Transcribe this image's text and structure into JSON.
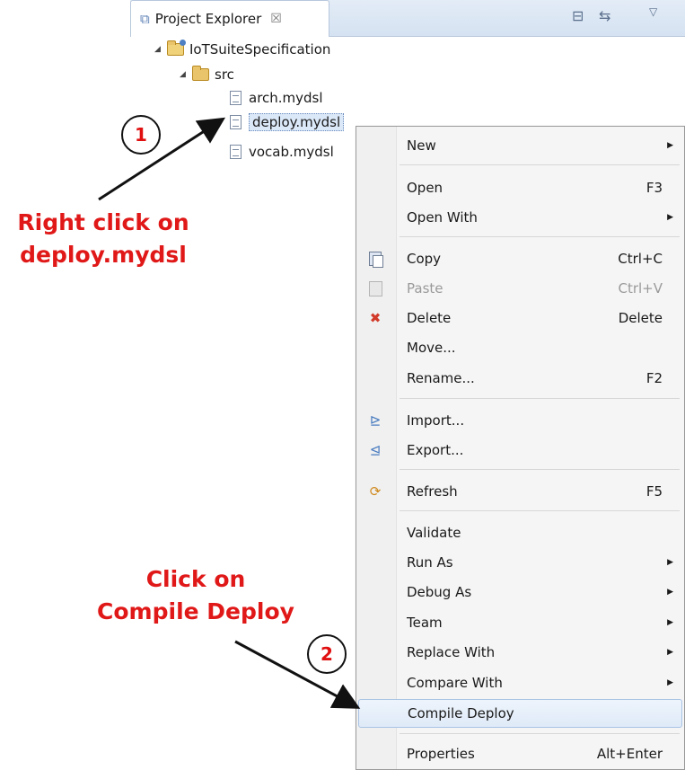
{
  "view": {
    "tab_title": "Project Explorer",
    "tab_close": "☒",
    "toolbar_collapse": "⊟",
    "toolbar_link": "⇆",
    "toolbar_menu": "▽"
  },
  "tree": {
    "project": "IoTSuiteSpecification",
    "folder": "src",
    "files": [
      "arch.mydsl",
      "deploy.mydsl",
      "vocab.mydsl"
    ],
    "selected_file": "deploy.mydsl"
  },
  "context_menu": {
    "items": [
      {
        "label": "New",
        "accel": "",
        "submenu": true
      },
      {
        "label": "Open",
        "accel": "F3",
        "submenu": false
      },
      {
        "label": "Open With",
        "accel": "",
        "submenu": true
      },
      {
        "label": "Copy",
        "accel": "Ctrl+C",
        "submenu": false,
        "icon": "copy-icon"
      },
      {
        "label": "Paste",
        "accel": "Ctrl+V",
        "submenu": false,
        "icon": "paste-icon",
        "disabled": true
      },
      {
        "label": "Delete",
        "accel": "Delete",
        "submenu": false,
        "icon": "delete-icon"
      },
      {
        "label": "Move...",
        "accel": "",
        "submenu": false
      },
      {
        "label": "Rename...",
        "accel": "F2",
        "submenu": false
      },
      {
        "label": "Import...",
        "accel": "",
        "submenu": false,
        "icon": "import-icon"
      },
      {
        "label": "Export...",
        "accel": "",
        "submenu": false,
        "icon": "export-icon"
      },
      {
        "label": "Refresh",
        "accel": "F5",
        "submenu": false,
        "icon": "refresh-icon"
      },
      {
        "label": "Validate",
        "accel": "",
        "submenu": false
      },
      {
        "label": "Run As",
        "accel": "",
        "submenu": true
      },
      {
        "label": "Debug As",
        "accel": "",
        "submenu": true
      },
      {
        "label": "Team",
        "accel": "",
        "submenu": true
      },
      {
        "label": "Replace With",
        "accel": "",
        "submenu": true
      },
      {
        "label": "Compare With",
        "accel": "",
        "submenu": true
      },
      {
        "label": "Compile Deploy",
        "accel": "",
        "submenu": false,
        "highlighted": true
      },
      {
        "label": "Properties",
        "accel": "Alt+Enter",
        "submenu": false
      }
    ],
    "submenu_arrow": "▶"
  },
  "annotations": {
    "step1_number": "1",
    "step1_line1": "Right click on",
    "step1_line2": "deploy.mydsl",
    "step2_number": "2",
    "step2_line1": "Click on",
    "step2_line2": "Compile Deploy",
    "color": "#e01818"
  }
}
